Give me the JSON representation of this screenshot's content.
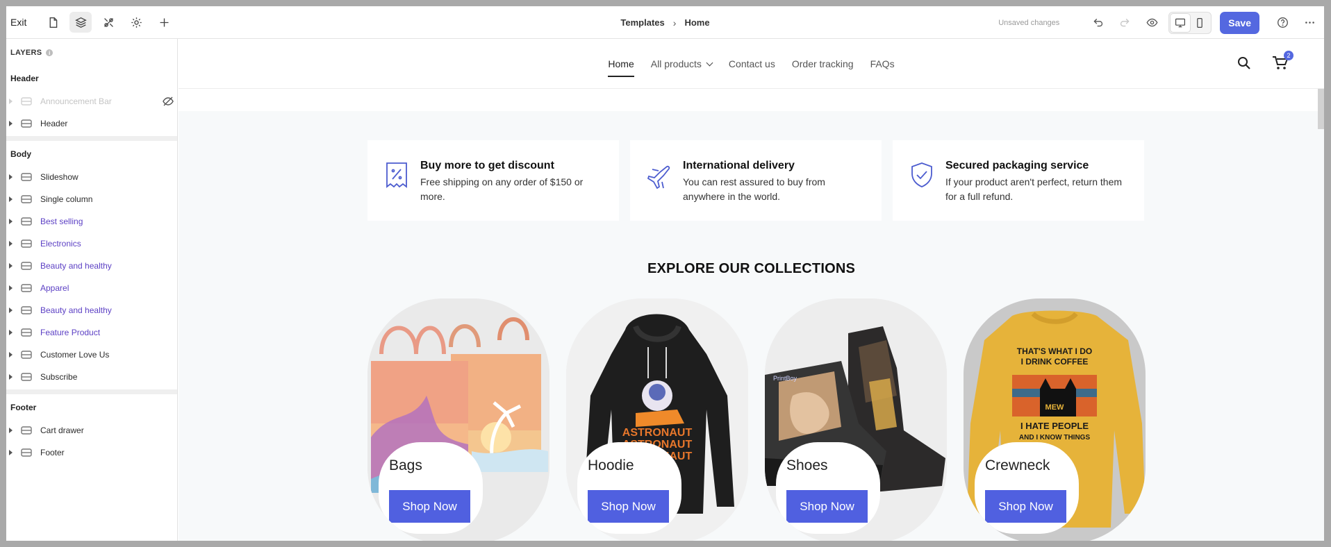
{
  "topbar": {
    "exit_label": "Exit",
    "breadcrumb": [
      "Templates",
      "Home"
    ],
    "unsaved": "Unsaved changes",
    "save_label": "Save"
  },
  "sidebar": {
    "title": "LAYERS",
    "info_mark": "i",
    "groups": [
      {
        "title": "Header",
        "items": [
          {
            "label": "Announcement Bar",
            "hidden": true
          },
          {
            "label": "Header"
          }
        ]
      },
      {
        "title": "Body",
        "items": [
          {
            "label": "Slideshow"
          },
          {
            "label": "Single column"
          },
          {
            "label": "Best selling"
          },
          {
            "label": "Electronics"
          },
          {
            "label": "Beauty and healthy"
          },
          {
            "label": "Apparel"
          },
          {
            "label": "Beauty and healthy"
          },
          {
            "label": "Feature Product"
          },
          {
            "label": "Customer Love Us"
          },
          {
            "label": "Subscribe"
          }
        ]
      },
      {
        "title": "Footer",
        "items": [
          {
            "label": "Cart drawer"
          },
          {
            "label": "Footer"
          }
        ]
      }
    ]
  },
  "store": {
    "nav": [
      "Home",
      "All products",
      "Contact us",
      "Order tracking",
      "FAQs"
    ],
    "cart_count": "2",
    "features": [
      {
        "title": "Buy more to get discount",
        "text": "Free shipping on any order of $150 or more.",
        "icon": "discount-tag-icon"
      },
      {
        "title": "International delivery",
        "text": "You can rest assured to buy from anywhere in the world.",
        "icon": "airplane-icon"
      },
      {
        "title": "Secured packaging service",
        "text": "If your product aren't perfect, return them for a full refund.",
        "icon": "shield-check-icon"
      }
    ],
    "collections_title": "EXPLORE OUR COLLECTIONS",
    "collections": [
      {
        "name": "Bags",
        "button": "Shop Now"
      },
      {
        "name": "Hoodie",
        "button": "Shop Now"
      },
      {
        "name": "Shoes",
        "button": "Shop Now"
      },
      {
        "name": "Crewneck",
        "button": "Shop Now"
      }
    ],
    "shirt_text": [
      "THAT'S WHAT I DO",
      "I DRINK COFFEE",
      "MEW",
      "I HATE PEOPLE",
      "AND I KNOW THINGS"
    ],
    "hoodie_text": [
      "ASTRONAUT",
      "ASTRONAUT",
      "ASTRONAUT"
    ],
    "shoe_text": "PrintBoy"
  },
  "colors": {
    "accent": "#5468e0",
    "button": "#5060e0",
    "purple_layer": "#5b3fc4"
  }
}
